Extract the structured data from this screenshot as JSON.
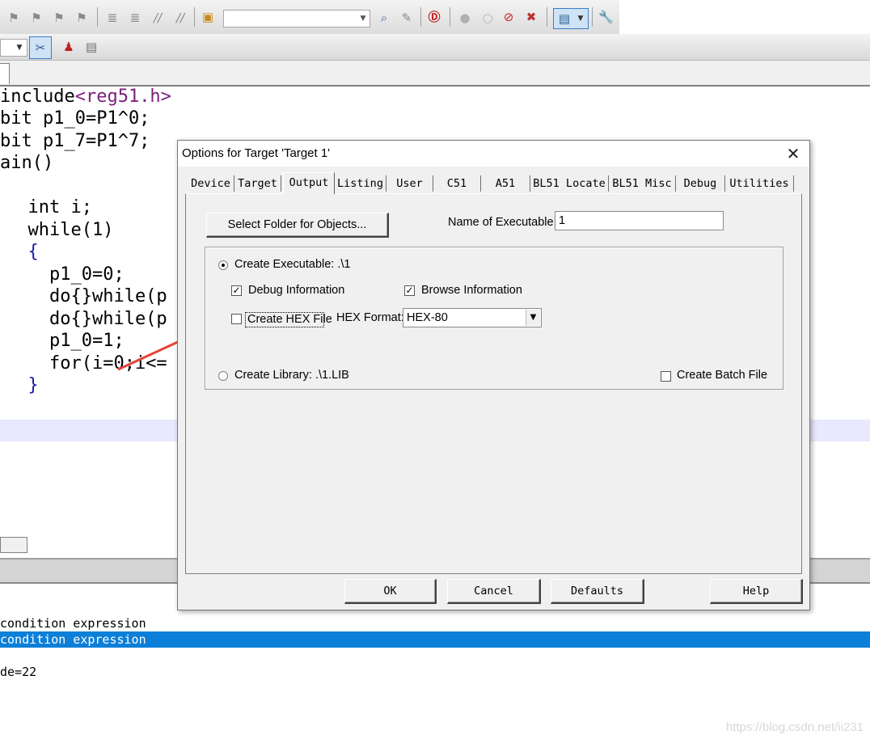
{
  "toolbar": {
    "icons": [
      "bookmark-prev-icon",
      "bookmark-next-icon",
      "bookmark-clear-icon",
      "bookmark-all-icon",
      "indent-icon",
      "unindent-icon",
      "comment-icon",
      "uncomment-icon",
      "find-in-files-icon",
      "find-icon",
      "configure-icon",
      "debug-start-icon",
      "breakpoint-icon",
      "breakpoint-disable-icon",
      "breakpoint-kill-icon",
      "window-layout-icon",
      "settings-wrench-icon"
    ],
    "find_combo_value": "",
    "row2_icons": [
      "translate-icon",
      "build-target-icon",
      "manage-components-icon",
      "select-packs-icon"
    ]
  },
  "editor": {
    "lines": [
      {
        "a": "include",
        "b": "<reg51.h>"
      },
      {
        "a": "bit p1_0=P1^0;"
      },
      {
        "a": "bit p1_7=P1^7;"
      },
      {
        "a": "ain()"
      },
      {
        "a": "  int i;"
      },
      {
        "a": "  while(1)"
      },
      {
        "a": "  {"
      },
      {
        "a": "    p1_0=0;"
      },
      {
        "a": "    do{}while(p"
      },
      {
        "a": "    do{}while(p"
      },
      {
        "a": "    p1_0=1;"
      },
      {
        "a": "    for(i=0;i<="
      },
      {
        "a": "  }"
      }
    ]
  },
  "output": {
    "lines": [
      "condition expression",
      "condition expression",
      "",
      "de=22"
    ],
    "selected_index": 1
  },
  "watermark": "https://blog.csdn.net/ii231",
  "dialog": {
    "title": "Options for Target 'Target 1'",
    "close_glyph": "✕",
    "tabs": [
      "Device",
      "Target",
      "Output",
      "Listing",
      "User",
      "C51",
      "A51",
      "BL51 Locate",
      "BL51 Misc",
      "Debug",
      "Utilities"
    ],
    "active_tab": "Output",
    "select_folder_label": "Select Folder for Objects...",
    "name_of_executable_label": "Name of Executable:",
    "name_of_executable_value": "1",
    "create_executable_label": "Create Executable:  .\\1",
    "create_executable_selected": true,
    "debug_information_label": "Debug Information",
    "debug_information_checked": true,
    "browse_information_label": "Browse Information",
    "browse_information_checked": true,
    "create_hex_file_label": "Create HEX File",
    "create_hex_file_checked": false,
    "hex_format_label": "HEX Format:",
    "hex_format_value": "HEX-80",
    "create_library_label": "Create Library:  .\\1.LIB",
    "create_library_selected": false,
    "create_batch_file_label": "Create Batch File",
    "create_batch_file_checked": false,
    "buttons": {
      "ok": "OK",
      "cancel": "Cancel",
      "defaults": "Defaults",
      "help": "Help"
    }
  },
  "annotation": {
    "arrow_color": "#e8443a"
  },
  "colors": {
    "selection_blue": "#0c7fd8",
    "caret_line": "#e8e8ff"
  }
}
